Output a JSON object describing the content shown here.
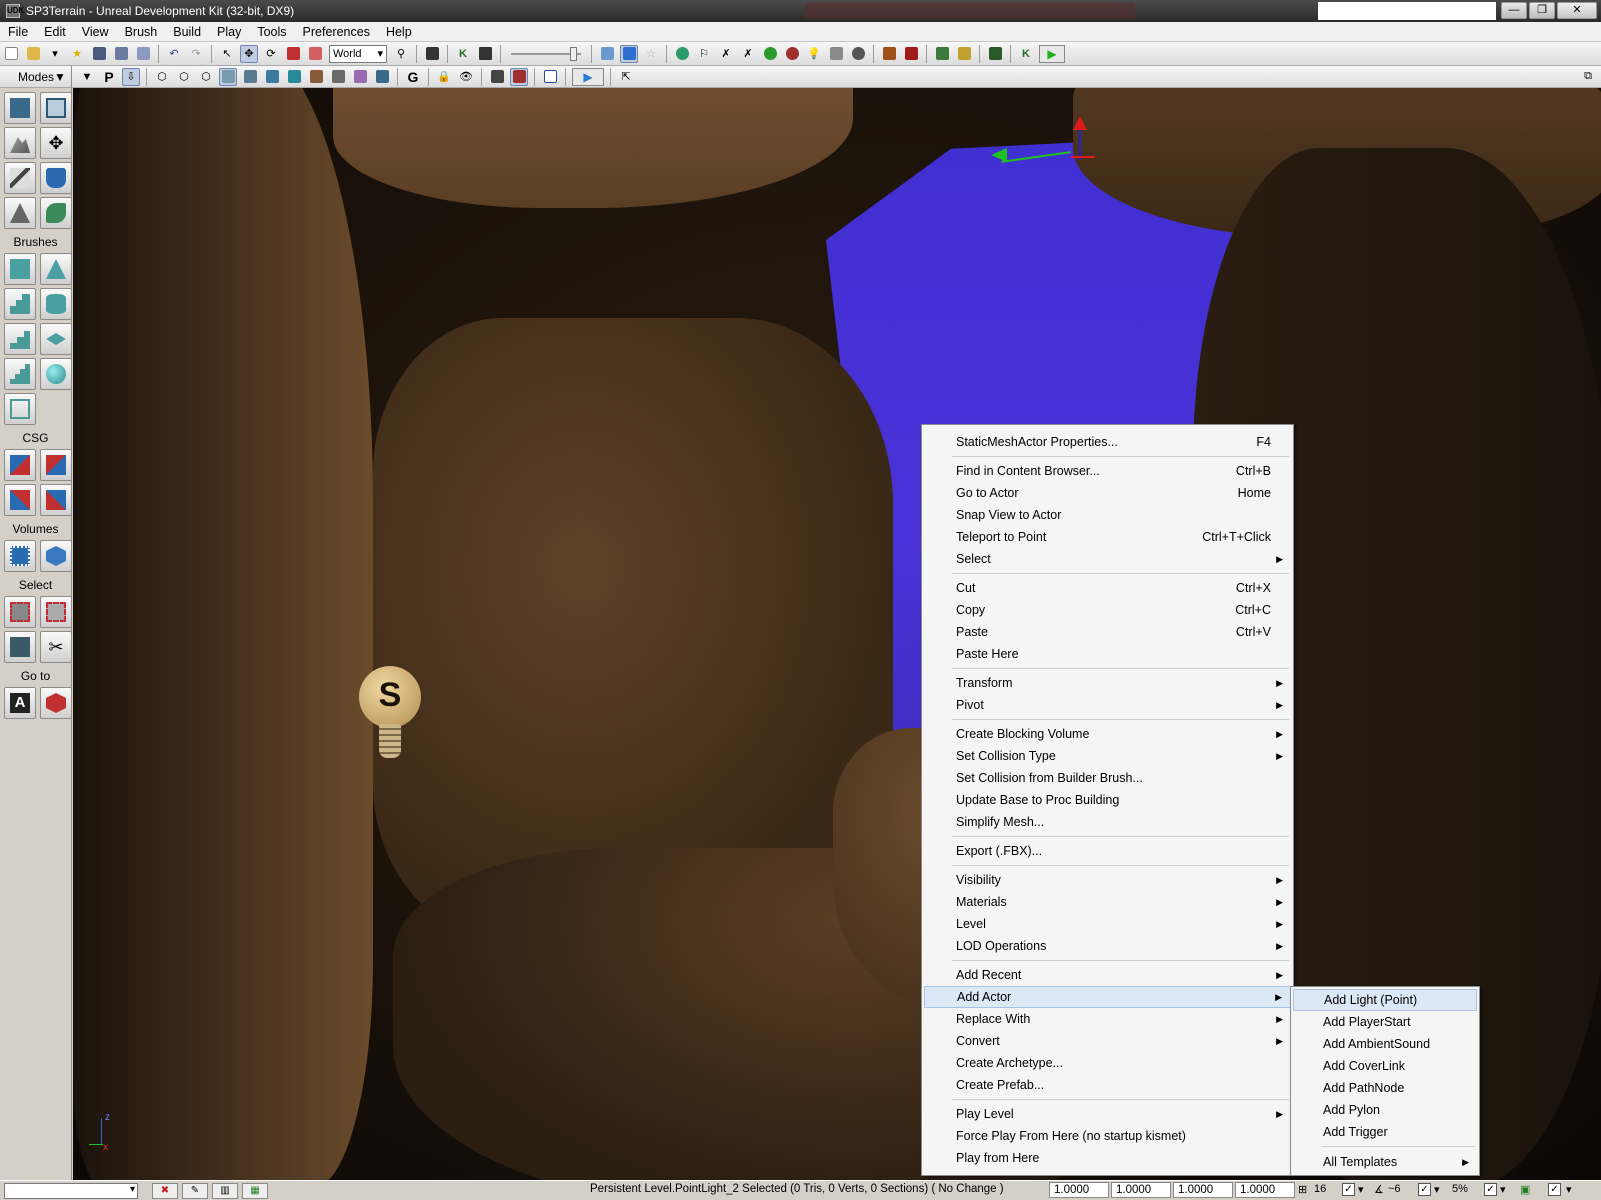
{
  "window": {
    "title": "SP3Terrain - Unreal Development Kit (32-bit, DX9)",
    "app_icon_text": "UDK",
    "buttons": {
      "minimize": "—",
      "maximize": "❐",
      "close": "✕"
    }
  },
  "menubar": {
    "items": [
      {
        "label": "File"
      },
      {
        "label": "Edit"
      },
      {
        "label": "View"
      },
      {
        "label": "Brush"
      },
      {
        "label": "Build"
      },
      {
        "label": "Play"
      },
      {
        "label": "Tools"
      },
      {
        "label": "Preferences"
      },
      {
        "label": "Help"
      }
    ]
  },
  "toolbar": {
    "coordinate_system": "World",
    "letter_buttons": [
      "P",
      "G"
    ]
  },
  "modes_panel": {
    "title": "Modes",
    "sections": [
      "Brushes",
      "CSG",
      "Volumes",
      "Select",
      "Go to"
    ]
  },
  "context_menu": {
    "items": [
      {
        "label": "StaticMeshActor Properties...",
        "shortcut": "F4"
      },
      {
        "label": "Find in Content Browser...",
        "shortcut": "Ctrl+B"
      },
      {
        "label": "Go to Actor",
        "shortcut": "Home"
      },
      {
        "label": "Snap View to Actor",
        "shortcut": ""
      },
      {
        "label": "Teleport to Point",
        "shortcut": "Ctrl+T+Click"
      },
      {
        "label": "Select",
        "shortcut": ""
      },
      {
        "label": "Cut",
        "shortcut": "Ctrl+X"
      },
      {
        "label": "Copy",
        "shortcut": "Ctrl+C"
      },
      {
        "label": "Paste",
        "shortcut": "Ctrl+V"
      },
      {
        "label": "Paste Here",
        "shortcut": ""
      },
      {
        "label": "Transform",
        "shortcut": ""
      },
      {
        "label": "Pivot",
        "shortcut": ""
      },
      {
        "label": "Create Blocking Volume",
        "shortcut": ""
      },
      {
        "label": "Set Collision Type",
        "shortcut": ""
      },
      {
        "label": "Set Collision from Builder Brush...",
        "shortcut": ""
      },
      {
        "label": "Update Base to Proc Building",
        "shortcut": ""
      },
      {
        "label": "Simplify Mesh...",
        "shortcut": ""
      },
      {
        "label": "Export (.FBX)...",
        "shortcut": ""
      },
      {
        "label": "Visibility",
        "shortcut": ""
      },
      {
        "label": "Materials",
        "shortcut": ""
      },
      {
        "label": "Level",
        "shortcut": ""
      },
      {
        "label": "LOD Operations",
        "shortcut": ""
      },
      {
        "label": "Add Recent",
        "shortcut": ""
      },
      {
        "label": "Add Actor",
        "shortcut": ""
      },
      {
        "label": "Replace With",
        "shortcut": ""
      },
      {
        "label": "Convert",
        "shortcut": ""
      },
      {
        "label": "Create Archetype...",
        "shortcut": ""
      },
      {
        "label": "Create Prefab...",
        "shortcut": ""
      },
      {
        "label": "Play Level",
        "shortcut": ""
      },
      {
        "label": "Force Play From Here (no startup kismet)",
        "shortcut": ""
      },
      {
        "label": "Play from Here",
        "shortcut": ""
      }
    ],
    "highlighted": "Add Actor"
  },
  "submenu": {
    "items": [
      {
        "label": "Add Light (Point)"
      },
      {
        "label": "Add PlayerStart"
      },
      {
        "label": "Add AmbientSound"
      },
      {
        "label": "Add CoverLink"
      },
      {
        "label": "Add PathNode"
      },
      {
        "label": "Add Pylon"
      },
      {
        "label": "Add Trigger"
      },
      {
        "label": "All Templates"
      }
    ],
    "highlighted": "Add Light (Point)"
  },
  "viewport": {
    "light_icon_letter": "S",
    "axis_labels": {
      "x": "x",
      "z": "z"
    }
  },
  "statusbar": {
    "status_text": "Persistent Level.PointLight_2 Selected (0 Tris, 0 Verts, 0 Sections) ( No Change )",
    "scale_values": [
      "1.0000",
      "1.0000",
      "1.0000",
      "1.0000"
    ],
    "grid_size": "16",
    "rotation_snap": "~6",
    "scale_snap": "5%"
  },
  "colors": {
    "sky_volume": "#3f2fd0",
    "menu_highlight": "#dde8f7",
    "rock_brown": "#6b4b2b"
  }
}
